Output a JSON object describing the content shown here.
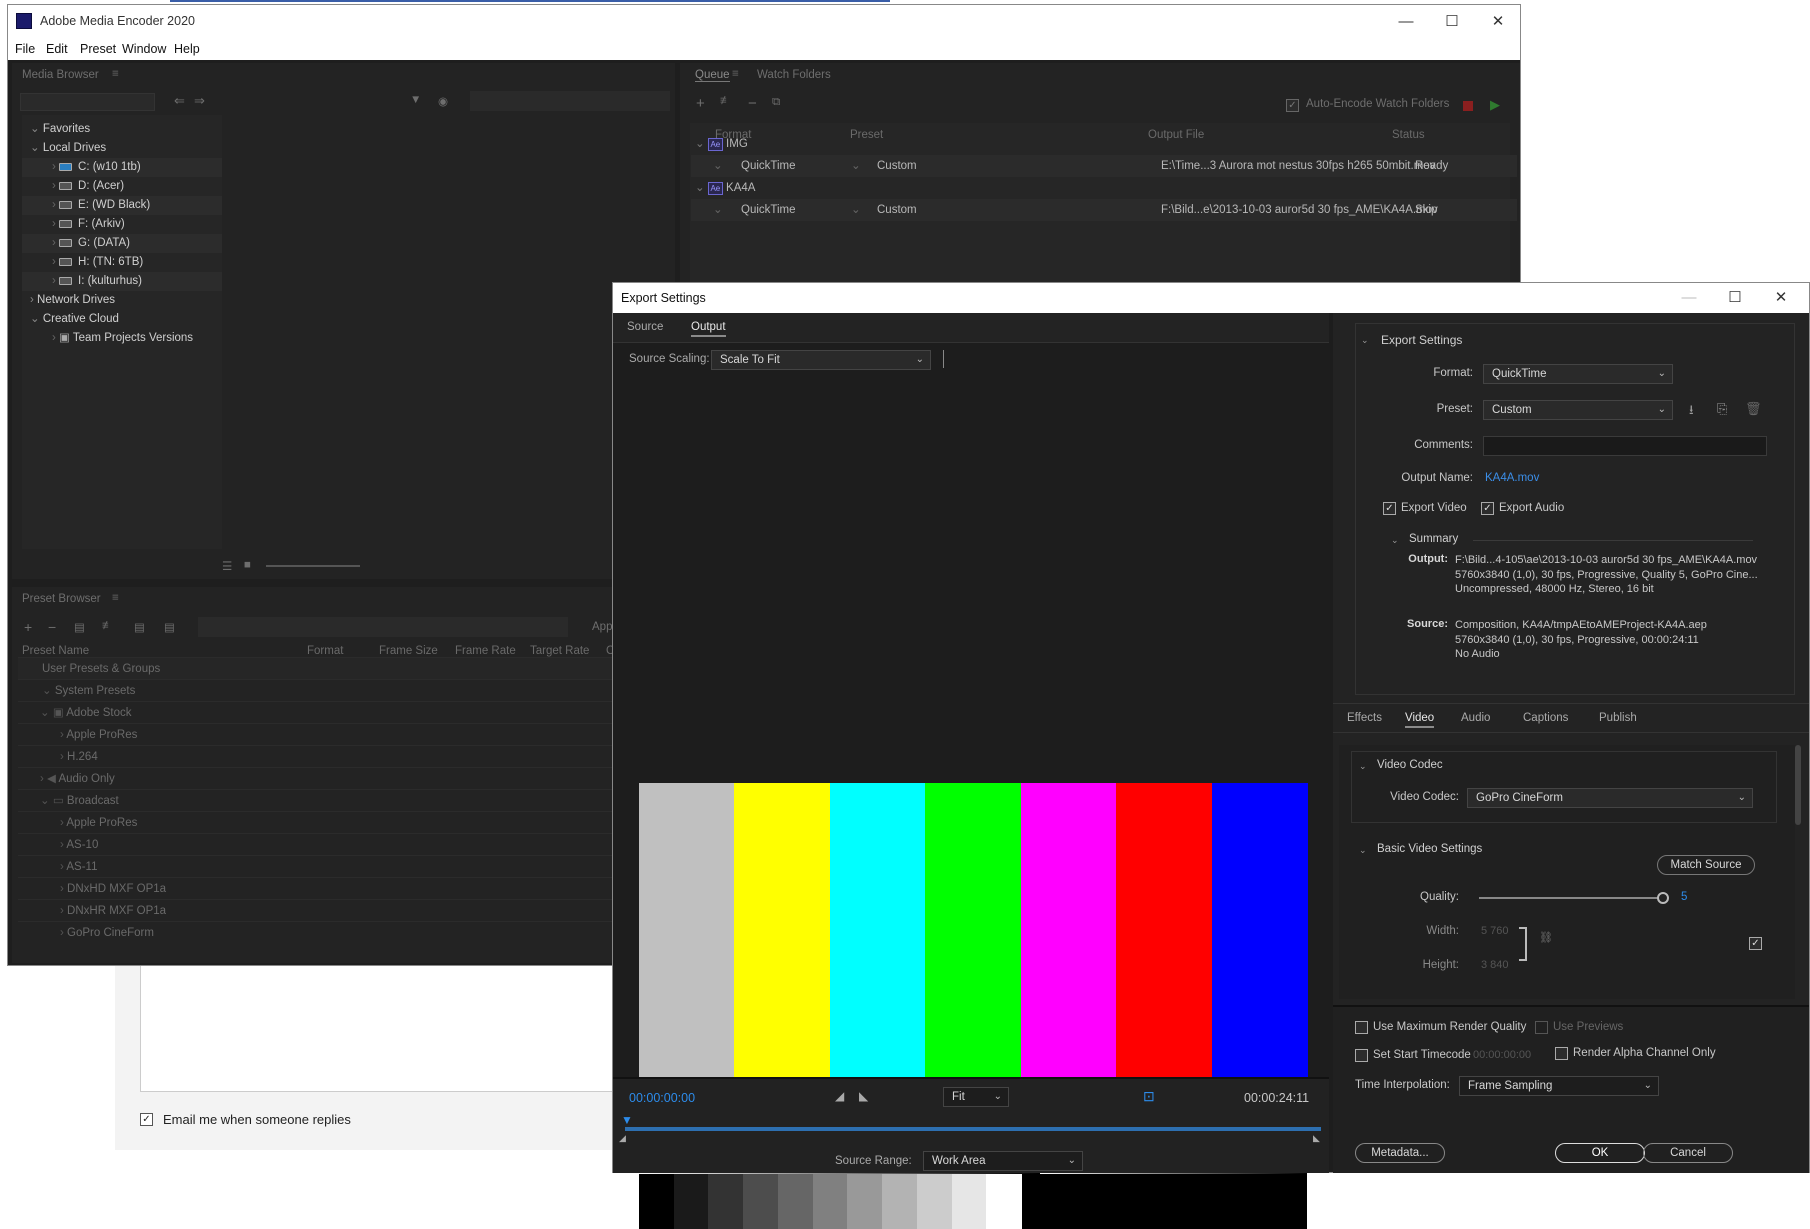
{
  "background_page": {
    "email_label": "Email me when someone replies",
    "email_checked": true
  },
  "ame": {
    "title": "Adobe Media Encoder 2020",
    "menu": [
      "File",
      "Edit",
      "Preset",
      "Window",
      "Help"
    ],
    "media_browser": {
      "title": "Media Browser",
      "favorites": "Favorites",
      "local_drives": "Local Drives",
      "drives": [
        "C: (w10 1tb)",
        "D: (Acer)",
        "E: (WD Black)",
        "F: (Arkiv)",
        "G: (DATA)",
        "H: (TN: 6TB)",
        "I: (kulturhus)"
      ],
      "network_drives": "Network Drives",
      "creative_cloud": "Creative Cloud",
      "team_projects": "Team Projects Versions"
    },
    "queue": {
      "tab_queue": "Queue",
      "tab_watch": "Watch Folders",
      "auto_encode": "Auto-Encode Watch Folders",
      "columns": [
        "Format",
        "Preset",
        "Output File",
        "Status"
      ],
      "groups": [
        {
          "name": "IMG",
          "format": "QuickTime",
          "preset": "Custom",
          "output": "E:\\Time...3 Aurora mot nestus 30fps h265 50mbit.mov",
          "status": "Ready"
        },
        {
          "name": "KA4A",
          "format": "QuickTime",
          "preset": "Custom",
          "output": "F:\\Bild...e\\2013-10-03 auror5d 30 fps_AME\\KA4A.mov",
          "status": "Skip"
        }
      ]
    },
    "preset_browser": {
      "title": "Preset Browser",
      "apply": "Apply",
      "columns": [
        "Preset Name",
        "Format",
        "Frame Size",
        "Frame Rate",
        "Target Rate",
        "C"
      ],
      "user_presets": "User Presets & Groups",
      "system_presets": "System Presets",
      "items": [
        "Adobe Stock",
        "Apple ProRes",
        "H.264",
        "Audio Only",
        "Broadcast",
        "Apple ProRes",
        "AS-10",
        "AS-11",
        "DNxHD MXF OP1a",
        "DNxHR MXF OP1a",
        "GoPro CineForm"
      ]
    }
  },
  "export": {
    "title": "Export Settings",
    "tabs": [
      "Source",
      "Output"
    ],
    "source_scaling_label": "Source Scaling:",
    "source_scaling_value": "Scale To Fit",
    "export_settings_header": "Export Settings",
    "format_label": "Format:",
    "format_value": "QuickTime",
    "preset_label": "Preset:",
    "preset_value": "Custom",
    "comments_label": "Comments:",
    "comments_value": "",
    "output_name_label": "Output Name:",
    "output_name_value": "KA4A.mov",
    "export_video": "Export Video",
    "export_audio": "Export Audio",
    "summary_header": "Summary",
    "output_label": "Output:",
    "output_lines": [
      "F:\\Bild...4-105\\ae\\2013-10-03 auror5d 30 fps_AME\\KA4A.mov",
      "5760x3840 (1,0), 30 fps, Progressive, Quality 5, GoPro Cine...",
      "Uncompressed, 48000 Hz, Stereo, 16 bit"
    ],
    "source_label": "Source:",
    "source_lines": [
      "Composition, KA4A/tmpAEtoAMEProject-KA4A.aep",
      "5760x3840 (1,0), 30 fps, Progressive, 00:00:24:11",
      "No Audio"
    ],
    "settings_tabs": [
      "Effects",
      "Video",
      "Audio",
      "Captions",
      "Publish"
    ],
    "video_codec_header": "Video Codec",
    "video_codec_label": "Video Codec:",
    "video_codec_value": "GoPro CineForm",
    "basic_video_header": "Basic Video Settings",
    "match_source": "Match Source",
    "quality_label": "Quality:",
    "quality_value": "5",
    "quality_fraction": 0.98,
    "width_label": "Width:",
    "width_value": "5 760",
    "height_label": "Height:",
    "height_value": "3 840",
    "use_max_render": "Use Maximum Render Quality",
    "use_previews": "Use Previews",
    "set_start_tc": "Set Start Timecode",
    "start_tc_value": "00:00:00:00",
    "render_alpha": "Render Alpha Channel Only",
    "time_interp_label": "Time Interpolation:",
    "time_interp_value": "Frame Sampling",
    "metadata_btn": "Metadata...",
    "ok_btn": "OK",
    "cancel_btn": "Cancel",
    "tc_start": "00:00:00:00",
    "tc_end": "00:00:24:11",
    "fit_value": "Fit",
    "source_range_label": "Source Range:",
    "source_range_value": "Work Area",
    "colors": {
      "accent": "#2d8ceb",
      "link": "#3b8ee8"
    }
  },
  "preview": {
    "top_bars": [
      "#c0c0c0",
      "#ffff00",
      "#00ffff",
      "#00ff00",
      "#ff00ff",
      "#ff0000",
      "#0000ff"
    ],
    "mid_bars": [
      "#0000ff",
      "#131313",
      "#ff00ff",
      "#131313",
      "#00ffff",
      "#131313",
      "#c0c0c0"
    ],
    "steps": [
      "#000000",
      "#1a1a1a",
      "#333333",
      "#4d4d4d",
      "#666666",
      "#808080",
      "#999999",
      "#b3b3b3",
      "#cccccc",
      "#e6e6e6",
      "#ffffff"
    ]
  }
}
